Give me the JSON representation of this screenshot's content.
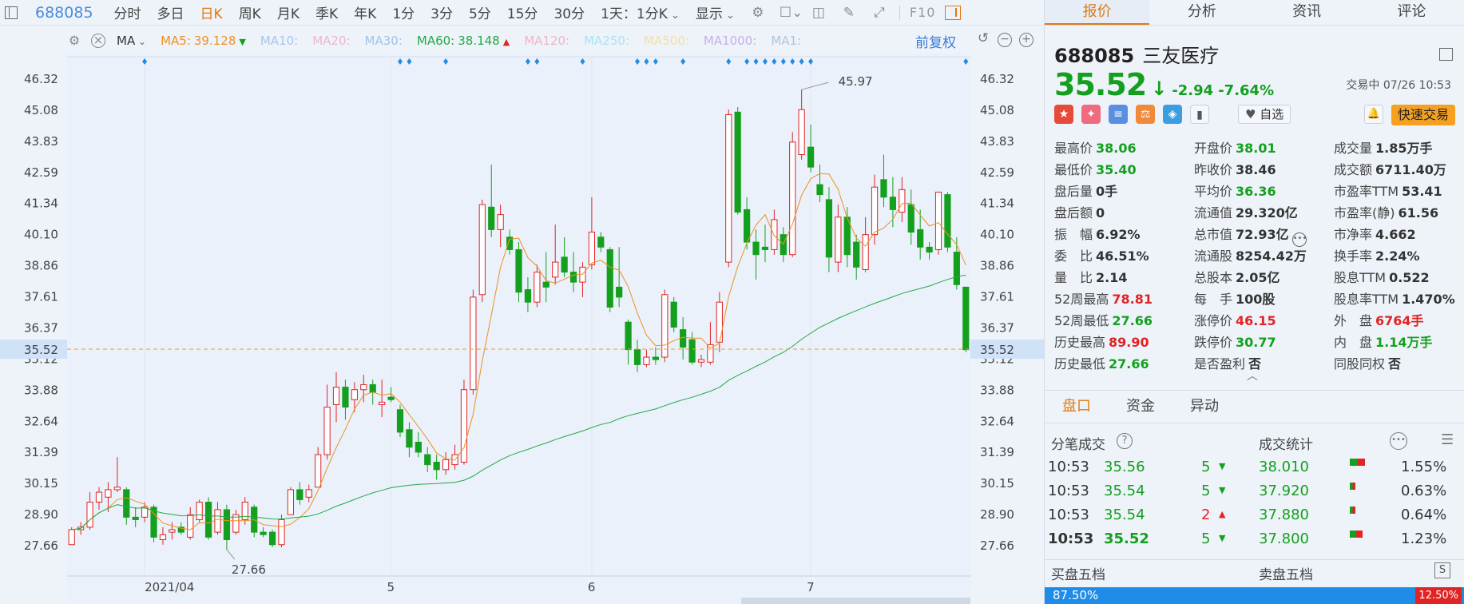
{
  "toolbar": {
    "code": "688085",
    "tabs": [
      "分时",
      "多日",
      "日K",
      "周K",
      "月K",
      "季K",
      "年K",
      "1分",
      "3分",
      "5分",
      "15分",
      "30分"
    ],
    "active_tab": "日K",
    "period_select": "1天：1分K",
    "display": "显示",
    "f10": "F10"
  },
  "ma_bar": {
    "label": "MA",
    "items": [
      {
        "name": "MA5:",
        "value": "39.128",
        "color": "#f0901e",
        "dir": "down"
      },
      {
        "name": "MA10:",
        "value": "",
        "color": "#a8c4ec",
        "dir": ""
      },
      {
        "name": "MA20:",
        "value": "",
        "color": "#f0b4d0",
        "dir": ""
      },
      {
        "name": "MA30:",
        "value": "",
        "color": "#9cc4ec",
        "dir": ""
      },
      {
        "name": "MA60:",
        "value": "38.148",
        "color": "#22aa44",
        "dir": "up"
      },
      {
        "name": "MA120:",
        "value": "",
        "color": "#f0b4c8",
        "dir": ""
      },
      {
        "name": "MA250:",
        "value": "",
        "color": "#a6e4f4",
        "dir": ""
      },
      {
        "name": "MA500:",
        "value": "",
        "color": "#f4e0a4",
        "dir": ""
      },
      {
        "name": "MA1000:",
        "value": "",
        "color": "#c4b0e8",
        "dir": ""
      },
      {
        "name": "MA1:",
        "value": "",
        "color": "#b0c4dc",
        "dir": ""
      }
    ],
    "adjust": "前复权"
  },
  "chart_data": {
    "type": "candlestick",
    "y_ticks": [
      "46.32",
      "45.08",
      "43.83",
      "42.59",
      "41.34",
      "40.10",
      "38.86",
      "37.61",
      "36.37",
      "35.12",
      "33.88",
      "32.64",
      "31.39",
      "30.15",
      "28.90",
      "27.66"
    ],
    "ylim": [
      27.66,
      46.32
    ],
    "x_labels": [
      "2021/04",
      "5",
      "6",
      "7"
    ],
    "current_price_label": "35.52",
    "max_label": "45.97",
    "min_label": "27.66",
    "candles": [
      {
        "o": 27.7,
        "h": 28.4,
        "l": 27.7,
        "c": 28.3
      },
      {
        "o": 28.3,
        "h": 28.6,
        "l": 28.1,
        "c": 28.4
      },
      {
        "o": 28.4,
        "h": 29.8,
        "l": 28.3,
        "c": 29.4
      },
      {
        "o": 29.4,
        "h": 30.0,
        "l": 29.1,
        "c": 29.8
      },
      {
        "o": 29.6,
        "h": 30.2,
        "l": 29.0,
        "c": 29.9
      },
      {
        "o": 29.9,
        "h": 31.2,
        "l": 29.8,
        "c": 30.0
      },
      {
        "o": 29.9,
        "h": 30.0,
        "l": 28.5,
        "c": 28.8
      },
      {
        "o": 28.8,
        "h": 29.2,
        "l": 28.4,
        "c": 28.7
      },
      {
        "o": 28.8,
        "h": 29.4,
        "l": 28.6,
        "c": 29.2
      },
      {
        "o": 29.2,
        "h": 29.3,
        "l": 27.8,
        "c": 28.0
      },
      {
        "o": 27.9,
        "h": 28.4,
        "l": 27.7,
        "c": 28.1
      },
      {
        "o": 28.2,
        "h": 28.6,
        "l": 27.9,
        "c": 28.3
      },
      {
        "o": 28.4,
        "h": 28.6,
        "l": 28.1,
        "c": 28.2
      },
      {
        "o": 28.0,
        "h": 29.2,
        "l": 27.9,
        "c": 28.9
      },
      {
        "o": 28.7,
        "h": 29.5,
        "l": 28.6,
        "c": 29.4
      },
      {
        "o": 29.4,
        "h": 29.6,
        "l": 27.9,
        "c": 28.0
      },
      {
        "o": 28.2,
        "h": 29.4,
        "l": 28.1,
        "c": 29.1
      },
      {
        "o": 29.1,
        "h": 29.3,
        "l": 27.5,
        "c": 27.9
      },
      {
        "o": 28.2,
        "h": 29.1,
        "l": 28.1,
        "c": 28.9
      },
      {
        "o": 28.7,
        "h": 29.6,
        "l": 28.5,
        "c": 29.4
      },
      {
        "o": 29.2,
        "h": 29.3,
        "l": 28.0,
        "c": 28.2
      },
      {
        "o": 28.2,
        "h": 28.4,
        "l": 28.0,
        "c": 28.1
      },
      {
        "o": 28.2,
        "h": 28.3,
        "l": 27.6,
        "c": 27.7
      },
      {
        "o": 27.7,
        "h": 28.9,
        "l": 27.6,
        "c": 28.7
      },
      {
        "o": 28.9,
        "h": 30.0,
        "l": 28.9,
        "c": 29.9
      },
      {
        "o": 29.9,
        "h": 30.2,
        "l": 29.3,
        "c": 29.5
      },
      {
        "o": 29.6,
        "h": 30.1,
        "l": 29.4,
        "c": 29.9
      },
      {
        "o": 30.0,
        "h": 31.6,
        "l": 30.0,
        "c": 31.3
      },
      {
        "o": 31.3,
        "h": 34.1,
        "l": 31.1,
        "c": 33.2
      },
      {
        "o": 33.3,
        "h": 34.6,
        "l": 32.6,
        "c": 34.0
      },
      {
        "o": 34.0,
        "h": 34.3,
        "l": 32.7,
        "c": 33.2
      },
      {
        "o": 33.5,
        "h": 34.2,
        "l": 33.0,
        "c": 33.9
      },
      {
        "o": 33.9,
        "h": 34.5,
        "l": 33.4,
        "c": 34.1
      },
      {
        "o": 34.1,
        "h": 34.3,
        "l": 33.3,
        "c": 33.8
      },
      {
        "o": 33.3,
        "h": 34.3,
        "l": 32.8,
        "c": 33.4
      },
      {
        "o": 33.6,
        "h": 34.0,
        "l": 33.4,
        "c": 33.5
      },
      {
        "o": 33.1,
        "h": 33.3,
        "l": 32.0,
        "c": 32.2
      },
      {
        "o": 32.3,
        "h": 32.6,
        "l": 31.2,
        "c": 31.6
      },
      {
        "o": 31.8,
        "h": 32.2,
        "l": 31.2,
        "c": 31.4
      },
      {
        "o": 31.3,
        "h": 31.6,
        "l": 30.6,
        "c": 30.9
      },
      {
        "o": 31.0,
        "h": 31.3,
        "l": 30.3,
        "c": 30.7
      },
      {
        "o": 30.7,
        "h": 31.4,
        "l": 30.5,
        "c": 31.1
      },
      {
        "o": 30.9,
        "h": 31.7,
        "l": 30.7,
        "c": 31.3
      },
      {
        "o": 31.0,
        "h": 34.3,
        "l": 30.9,
        "c": 33.9
      },
      {
        "o": 33.9,
        "h": 37.9,
        "l": 33.7,
        "c": 37.6
      },
      {
        "o": 37.7,
        "h": 41.5,
        "l": 37.4,
        "c": 41.3
      },
      {
        "o": 41.2,
        "h": 42.9,
        "l": 40.0,
        "c": 40.3
      },
      {
        "o": 40.3,
        "h": 41.3,
        "l": 39.6,
        "c": 40.9
      },
      {
        "o": 40.0,
        "h": 40.3,
        "l": 39.3,
        "c": 39.5
      },
      {
        "o": 39.5,
        "h": 39.8,
        "l": 37.4,
        "c": 37.8
      },
      {
        "o": 37.9,
        "h": 38.4,
        "l": 37.0,
        "c": 37.4
      },
      {
        "o": 37.4,
        "h": 38.9,
        "l": 37.2,
        "c": 38.6
      },
      {
        "o": 38.2,
        "h": 39.4,
        "l": 37.4,
        "c": 38.0
      },
      {
        "o": 38.4,
        "h": 40.5,
        "l": 38.1,
        "c": 39.0
      },
      {
        "o": 39.2,
        "h": 40.0,
        "l": 38.4,
        "c": 38.6
      },
      {
        "o": 38.6,
        "h": 39.4,
        "l": 37.8,
        "c": 38.2
      },
      {
        "o": 38.2,
        "h": 39.0,
        "l": 37.6,
        "c": 38.8
      },
      {
        "o": 38.9,
        "h": 41.6,
        "l": 38.7,
        "c": 40.2
      },
      {
        "o": 40.0,
        "h": 40.2,
        "l": 39.4,
        "c": 39.6
      },
      {
        "o": 39.5,
        "h": 39.6,
        "l": 37.0,
        "c": 37.2
      },
      {
        "o": 38.0,
        "h": 39.6,
        "l": 37.2,
        "c": 37.6
      },
      {
        "o": 36.6,
        "h": 36.7,
        "l": 34.9,
        "c": 35.5
      },
      {
        "o": 35.5,
        "h": 35.9,
        "l": 34.6,
        "c": 34.9
      },
      {
        "o": 34.9,
        "h": 35.5,
        "l": 34.8,
        "c": 35.2
      },
      {
        "o": 35.2,
        "h": 35.6,
        "l": 34.9,
        "c": 35.1
      },
      {
        "o": 35.2,
        "h": 37.9,
        "l": 35.0,
        "c": 37.7
      },
      {
        "o": 37.4,
        "h": 37.6,
        "l": 36.2,
        "c": 36.4
      },
      {
        "o": 36.3,
        "h": 36.8,
        "l": 35.1,
        "c": 35.6
      },
      {
        "o": 35.9,
        "h": 36.2,
        "l": 34.9,
        "c": 35.0
      },
      {
        "o": 35.0,
        "h": 35.3,
        "l": 34.8,
        "c": 35.1
      },
      {
        "o": 35.0,
        "h": 36.6,
        "l": 34.9,
        "c": 35.7
      },
      {
        "o": 35.8,
        "h": 37.8,
        "l": 35.4,
        "c": 37.4
      },
      {
        "o": 39.0,
        "h": 45.1,
        "l": 38.8,
        "c": 44.9
      },
      {
        "o": 45.0,
        "h": 45.2,
        "l": 40.9,
        "c": 41.0
      },
      {
        "o": 41.1,
        "h": 41.6,
        "l": 39.5,
        "c": 39.8
      },
      {
        "o": 39.8,
        "h": 40.3,
        "l": 38.3,
        "c": 39.3
      },
      {
        "o": 39.6,
        "h": 40.5,
        "l": 39.0,
        "c": 39.5
      },
      {
        "o": 39.5,
        "h": 41.1,
        "l": 39.3,
        "c": 40.7
      },
      {
        "o": 40.1,
        "h": 40.4,
        "l": 39.0,
        "c": 39.3
      },
      {
        "o": 39.3,
        "h": 44.2,
        "l": 39.2,
        "c": 43.8
      },
      {
        "o": 43.3,
        "h": 45.9,
        "l": 43.1,
        "c": 45.1
      },
      {
        "o": 43.6,
        "h": 44.5,
        "l": 42.6,
        "c": 42.8
      },
      {
        "o": 42.1,
        "h": 42.9,
        "l": 41.4,
        "c": 41.7
      },
      {
        "o": 41.5,
        "h": 42.0,
        "l": 38.6,
        "c": 39.2
      },
      {
        "o": 39.0,
        "h": 41.3,
        "l": 38.6,
        "c": 40.8
      },
      {
        "o": 40.8,
        "h": 41.2,
        "l": 38.8,
        "c": 39.3
      },
      {
        "o": 39.8,
        "h": 40.1,
        "l": 38.3,
        "c": 38.8
      },
      {
        "o": 38.7,
        "h": 40.8,
        "l": 38.6,
        "c": 40.1
      },
      {
        "o": 40.1,
        "h": 42.5,
        "l": 39.7,
        "c": 42.0
      },
      {
        "o": 42.3,
        "h": 43.3,
        "l": 41.2,
        "c": 41.6
      },
      {
        "o": 41.6,
        "h": 42.4,
        "l": 40.4,
        "c": 41.1
      },
      {
        "o": 41.0,
        "h": 42.4,
        "l": 40.6,
        "c": 41.9
      },
      {
        "o": 41.3,
        "h": 41.9,
        "l": 39.7,
        "c": 40.2
      },
      {
        "o": 40.3,
        "h": 41.1,
        "l": 39.1,
        "c": 39.6
      },
      {
        "o": 39.6,
        "h": 39.8,
        "l": 39.1,
        "c": 39.4
      },
      {
        "o": 39.5,
        "h": 41.8,
        "l": 39.3,
        "c": 41.8
      },
      {
        "o": 41.7,
        "h": 41.8,
        "l": 39.4,
        "c": 39.6
      },
      {
        "o": 39.4,
        "h": 40.0,
        "l": 37.9,
        "c": 38.1
      },
      {
        "o": 38.0,
        "h": 38.0,
        "l": 35.4,
        "c": 35.5
      }
    ]
  },
  "header": {
    "code": "688085",
    "name": "三友医疗",
    "price": "35.52",
    "change": "-2.94",
    "change_pct": "-7.64%",
    "trade_time": "交易中 07/26 10:53"
  },
  "right_tabs": [
    "报价",
    "分析",
    "资讯",
    "评论"
  ],
  "zixuan": "自选",
  "fast_trade": "快速交易",
  "stats": [
    [
      {
        "k": "最高价",
        "v": "38.06",
        "c": "green"
      },
      {
        "k": "开盘价",
        "v": "38.01",
        "c": "green"
      },
      {
        "k": "成交量",
        "v": "1.85万手",
        "c": ""
      }
    ],
    [
      {
        "k": "最低价",
        "v": "35.40",
        "c": "green"
      },
      {
        "k": "昨收价",
        "v": "38.46",
        "c": ""
      },
      {
        "k": "成交额",
        "v": "6711.40万",
        "c": ""
      }
    ],
    [
      {
        "k": "盘后量",
        "v": "0手",
        "c": ""
      },
      {
        "k": "平均价",
        "v": "36.36",
        "c": "green"
      },
      {
        "k": "市盈率TTM",
        "v": "53.41",
        "c": ""
      }
    ],
    [
      {
        "k": "盘后额",
        "v": "0",
        "c": ""
      },
      {
        "k": "流通值",
        "v": "29.320亿",
        "c": ""
      },
      {
        "k": "市盈率(静)",
        "v": "61.56",
        "c": ""
      }
    ],
    [
      {
        "k": "振　幅",
        "v": "6.92%",
        "c": ""
      },
      {
        "k": "总市值",
        "v": "72.93亿",
        "c": ""
      },
      {
        "k": "市净率",
        "v": "4.662",
        "c": ""
      }
    ],
    [
      {
        "k": "委　比",
        "v": "46.51%",
        "c": ""
      },
      {
        "k": "流通股",
        "v": "8254.42万",
        "c": ""
      },
      {
        "k": "换手率",
        "v": "2.24%",
        "c": ""
      }
    ],
    [
      {
        "k": "量　比",
        "v": "2.14",
        "c": ""
      },
      {
        "k": "总股本",
        "v": "2.05亿",
        "c": ""
      },
      {
        "k": "股息TTM",
        "v": "0.522",
        "c": ""
      }
    ],
    [
      {
        "k": "52周最高",
        "v": "78.81",
        "c": "red"
      },
      {
        "k": "每　手",
        "v": "100股",
        "c": ""
      },
      {
        "k": "股息率TTM",
        "v": "1.470%",
        "c": ""
      }
    ],
    [
      {
        "k": "52周最低",
        "v": "27.66",
        "c": "green"
      },
      {
        "k": "涨停价",
        "v": "46.15",
        "c": "red"
      },
      {
        "k": "外　盘",
        "v": "6764手",
        "c": "red"
      }
    ],
    [
      {
        "k": "历史最高",
        "v": "89.90",
        "c": "red"
      },
      {
        "k": "跌停价",
        "v": "30.77",
        "c": "green"
      },
      {
        "k": "内　盘",
        "v": "1.14万手",
        "c": "green"
      }
    ],
    [
      {
        "k": "历史最低",
        "v": "27.66",
        "c": "green"
      },
      {
        "k": "是否盈利",
        "v": "否",
        "c": ""
      },
      {
        "k": "同股同权",
        "v": "否",
        "c": ""
      }
    ]
  ],
  "sub_tabs": [
    "盘口",
    "资金",
    "异动"
  ],
  "tick_section": {
    "left_title": "分笔成交",
    "right_title": "成交统计"
  },
  "trades": [
    {
      "time": "10:53",
      "price": "35.56",
      "vol": "5",
      "dir": "down",
      "stat_price": "38.010",
      "pct": "1.55%",
      "bar": 0.8
    },
    {
      "time": "10:53",
      "price": "35.54",
      "vol": "5",
      "dir": "down",
      "stat_price": "37.920",
      "pct": "0.63%",
      "bar": 0.3
    },
    {
      "time": "10:53",
      "price": "35.54",
      "vol": "2",
      "dir": "up",
      "stat_price": "37.880",
      "pct": "0.64%",
      "bar": 0.3
    },
    {
      "time": "10:53",
      "price": "35.52",
      "vol": "5",
      "dir": "down",
      "stat_price": "37.800",
      "pct": "1.23%",
      "bar": 0.65
    }
  ],
  "five_levels": {
    "buy": "买盘五档",
    "sell": "卖盘五档",
    "buy_pct": "87.50%",
    "sell_pct": "12.50%"
  },
  "colors": {
    "up": "#e02424",
    "down": "#14a01e",
    "ma5": "#f0901e",
    "ma60": "#22aa44",
    "accent": "#e07810"
  }
}
